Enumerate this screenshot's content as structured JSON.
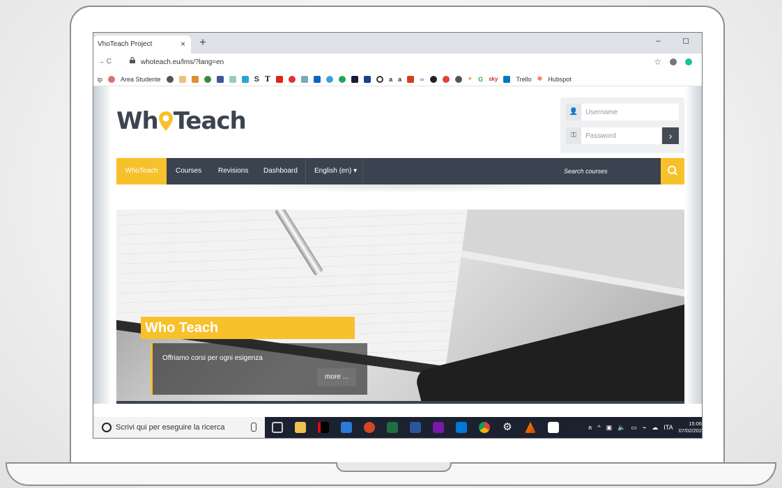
{
  "browser": {
    "tab_title": "VhoTeach Project",
    "tab_close": "×",
    "new_tab": "+",
    "window_controls": "–   ◻",
    "nav_buttons": "→  C",
    "url": "whoteach.eu/lms/?lang=en",
    "bookmarks": [
      "Area Studente",
      "Trello",
      "Hubspot"
    ],
    "bookmark_prefix": "ip"
  },
  "site": {
    "logo_part1": "Wh",
    "logo_part2": "Teach",
    "login": {
      "username_placeholder": "Username",
      "password_placeholder": "Password",
      "submit_icon": "›"
    },
    "nav": {
      "items": [
        "WhoTeach",
        "Courses",
        "Revisions",
        "Dashboard",
        "English (en) ▾"
      ],
      "search_placeholder": "Search courses"
    },
    "hero": {
      "title": "Who Teach",
      "subtitle": "Offriamo corsi per ogni esigenza",
      "more": "more ..."
    }
  },
  "taskbar": {
    "search_text": "Scrivi qui per eseguire la ricerca",
    "language": "ITA",
    "time": "15:06",
    "date": "07/02/202"
  },
  "colors": {
    "accent": "#f7c12b",
    "navbar": "#3b4350",
    "taskbar": "#1c2130"
  }
}
